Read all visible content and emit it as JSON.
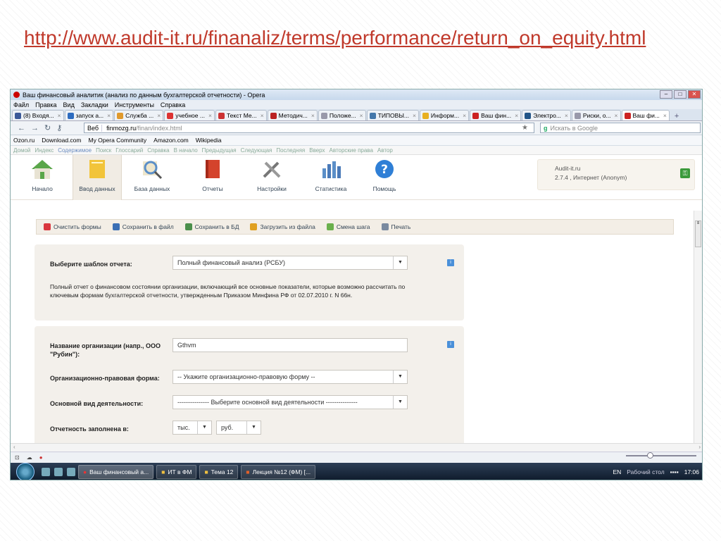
{
  "slide_url": "http://www.audit-it.ru/finanaliz/terms/performance/return_on_equity.html",
  "window": {
    "title": "Ваш финансовый аналитик (анализ по данным бухгалтерской отчетности) - Opera",
    "menu": [
      "Файл",
      "Правка",
      "Вид",
      "Закладки",
      "Инструменты",
      "Справка"
    ]
  },
  "tabs": [
    {
      "label": "(8) Входя...",
      "color": "#3b5998"
    },
    {
      "label": "запуск а...",
      "color": "#2d6cc0"
    },
    {
      "label": "Служба ...",
      "color": "#e09a2d"
    },
    {
      "label": "учебное ...",
      "color": "#d33"
    },
    {
      "label": "Текст Ме...",
      "color": "#c33"
    },
    {
      "label": "Методич...",
      "color": "#b22"
    },
    {
      "label": "Положе...",
      "color": "#99a"
    },
    {
      "label": "ТИПОВЫ...",
      "color": "#47a"
    },
    {
      "label": "Информ...",
      "color": "#e8b020"
    },
    {
      "label": "Ваш фин...",
      "color": "#c22"
    },
    {
      "label": "Электро...",
      "color": "#258"
    },
    {
      "label": "Риски, о...",
      "color": "#99a"
    },
    {
      "label": "Ваш фи...",
      "color": "#c22"
    }
  ],
  "address": {
    "web_label": "Веб",
    "host": "finmozg.ru",
    "path": "/finan/index.html",
    "search_placeholder": "Искать в Google"
  },
  "bookmarks": [
    "Ozon.ru",
    "Download.com",
    "My Opera Community",
    "Amazon.com",
    "Wikipedia"
  ],
  "nav_links": [
    "Домой",
    "Индекс",
    "Содержимое",
    "Поиск",
    "Глоссарий",
    "Справка",
    "В начало",
    "Предыдущая",
    "Следующая",
    "Последняя",
    "Вверх",
    "Авторские права",
    "Автор"
  ],
  "app_menu": [
    {
      "label": "Начало",
      "icon": "house-icon",
      "color": "#5aa64a"
    },
    {
      "label": "Ввод данных",
      "icon": "notes-icon",
      "color": "#f2c43a"
    },
    {
      "label": "База данных",
      "icon": "magnifier-icon",
      "color": "#e6b84a"
    },
    {
      "label": "Отчеты",
      "icon": "book-icon",
      "color": "#d4432c"
    },
    {
      "label": "Настройки",
      "icon": "tools-icon",
      "color": "#777777"
    },
    {
      "label": "Статистика",
      "icon": "chart-icon",
      "color": "#5b8fc8"
    },
    {
      "label": "Помощь",
      "icon": "help-icon",
      "color": "#2f7fd6"
    }
  ],
  "info": {
    "site": "Audit-it.ru",
    "version": "2.7.4 , Интернет (Anonym)"
  },
  "toolbar": [
    {
      "label": "Очистить формы",
      "color": "#d9363e"
    },
    {
      "label": "Сохранить в файл",
      "color": "#3b6fb5"
    },
    {
      "label": "Сохранить в БД",
      "color": "#4b8f4b"
    },
    {
      "label": "Загрузить из файла",
      "color": "#e0a020"
    },
    {
      "label": "Смена шага",
      "color": "#6ab04c"
    },
    {
      "label": "Печать",
      "color": "#7a8aa0"
    }
  ],
  "form": {
    "template_label": "Выберите шаблон отчета:",
    "template_value": "Полный финансовый анализ (РСБУ)",
    "template_desc": "Полный отчет о финансовом состоянии организации, включающий все основные показатели, которые возможно рассчитать по ключевым формам бухгалтерской отчетности, утвержденным Приказом Минфина РФ от 02.07.2010 г. N 66н.",
    "org_label": "Название организации (напр., ООО \"Рубин\"):",
    "org_value": "Gthvm",
    "legal_label": "Организационно-правовая форма:",
    "legal_value": "-- Укажите организационно-правовую форму --",
    "activity_label": "Основной вид деятельности:",
    "activity_value": "--------------- Выберите основной вид деятельности ---------------",
    "units_label": "Отчетность заполнена в:",
    "units_scale": "тыс.",
    "units_currency": "руб."
  },
  "taskbar": {
    "items": [
      "Ваш финансовый а...",
      "ИТ в ФМ",
      "Тема 12",
      "Лекция №12 (ФМ) [..."
    ],
    "lang": "EN",
    "desktop": "Рабочий стол",
    "time": "17:06"
  }
}
